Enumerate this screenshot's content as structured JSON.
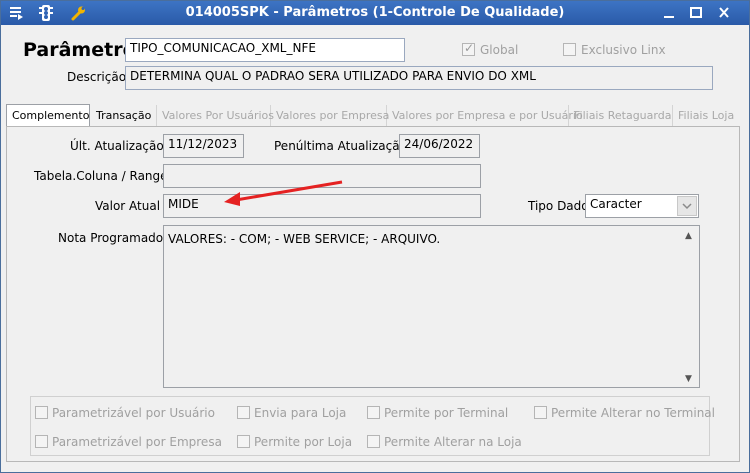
{
  "window": {
    "title": "014005SPK - Parâmetros (1-Controle De Qualidade)"
  },
  "header": {
    "parametro_label": "Parâmetro",
    "parametro_value": "TIPO_COMUNICACAO_XML_NFE",
    "global_label": "Global",
    "global_checked": true,
    "exclusivo_label": "Exclusivo Linx",
    "exclusivo_checked": false,
    "descricao_label": "Descrição",
    "descricao_value": "DETERMINA QUAL O PADRAO SERA UTILIZADO PARA ENVIO DO XML"
  },
  "tabs": [
    {
      "label": "Complemento",
      "active": true
    },
    {
      "label": "Transação"
    },
    {
      "label": "Valores Por Usuários"
    },
    {
      "label": "Valores por Empresa"
    },
    {
      "label": "Valores por Empresa e por Usuário"
    },
    {
      "label": "Filiais Retaguarda"
    },
    {
      "label": "Filiais Loja"
    }
  ],
  "complemento": {
    "ult_atualizacao_label": "Últ. Atualização",
    "ult_atualizacao_value": "11/12/2023",
    "penultima_label": "Penúltima Atualização",
    "penultima_value": "24/06/2022",
    "tabela_coluna_label": "Tabela.Coluna / Range",
    "tabela_coluna_value": "",
    "valor_atual_label": "Valor Atual",
    "valor_atual_value": "MIDE",
    "tipo_dado_label": "Tipo Dado",
    "tipo_dado_value": "Caracter",
    "nota_label": "Nota Programador",
    "nota_value": "VALORES:  - COM;  - WEB SERVICE;  - ARQUIVO."
  },
  "options": [
    {
      "label": "Parametrizável por Usuário"
    },
    {
      "label": "Envia para Loja"
    },
    {
      "label": "Permite por Terminal"
    },
    {
      "label": "Permite Alterar no Terminal"
    },
    {
      "label": "Parametrizável por Empresa"
    },
    {
      "label": "Permite por Loja"
    },
    {
      "label": "Permite Alterar na Loja"
    }
  ],
  "colors": {
    "titlebar": "#2f63b4",
    "annotation_arrow": "#e52222"
  },
  "icons": [
    "app-menu-icon",
    "traffic-light-icon",
    "wrench-icon",
    "minimize-icon",
    "maximize-icon",
    "close-icon",
    "dropdown-arrow-icon",
    "scroll-up-icon",
    "scroll-down-icon",
    "red-arrow-annotation"
  ]
}
